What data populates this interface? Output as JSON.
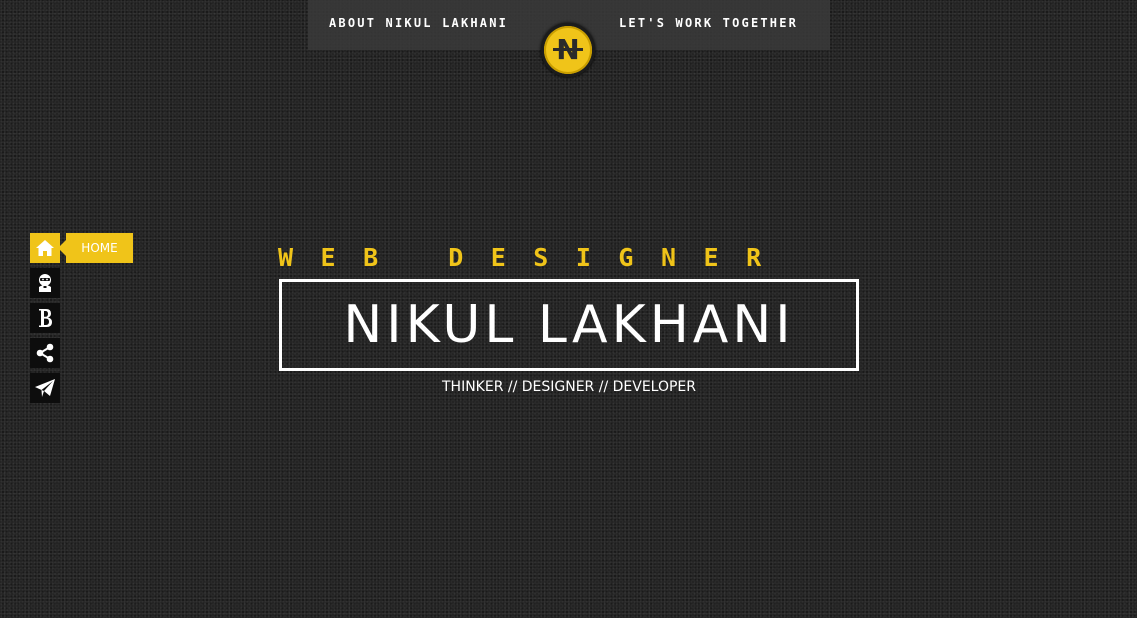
{
  "nav": {
    "about_label": "ABOUT NIKUL LAKHANI",
    "work_label": "LET'S WORK TOGETHER",
    "logo_letter": "N"
  },
  "sidebar": {
    "items": [
      {
        "name": "home",
        "icon": "home-icon",
        "tooltip": "HOME",
        "active": true
      },
      {
        "name": "ninja",
        "icon": "ninja-icon",
        "active": false
      },
      {
        "name": "blog",
        "icon": "bold-b-icon",
        "glyph": "B",
        "active": false
      },
      {
        "name": "share",
        "icon": "share-icon",
        "active": false
      },
      {
        "name": "contact",
        "icon": "paper-plane-icon",
        "active": false
      }
    ]
  },
  "hero": {
    "subtitle": "WEB DESIGNER",
    "name": "NIKUL LAKHANI",
    "tagline": "THINKER // DESIGNER // DEVELOPER"
  },
  "colors": {
    "accent": "#f0c419",
    "background": "#242424",
    "text": "#ffffff",
    "icon_bg": "#0d0d0d"
  }
}
